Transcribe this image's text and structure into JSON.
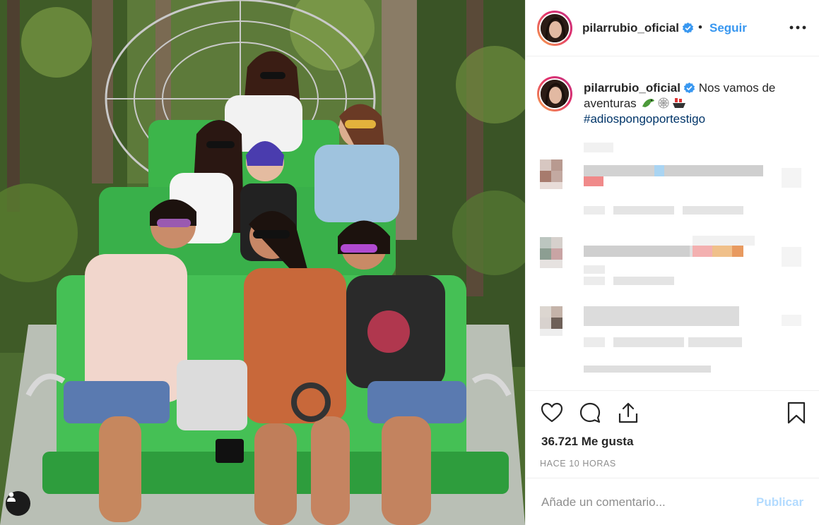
{
  "post": {
    "username": "pilarrubio_oficial",
    "follow_label": "Seguir",
    "separator": "•",
    "caption_text": "Nos vamos de aventuras",
    "hashtag": "#adiospongoportestigo",
    "emoji_icons": [
      "crocodile-icon",
      "spider-web-icon",
      "ship-icon"
    ],
    "likes_text": "36.721 Me gusta",
    "time_text": "HACE 10 HORAS",
    "comment_placeholder": "Añade un comentario...",
    "publish_label": "Publicar"
  },
  "icons": {
    "header": [
      "verified-badge-icon",
      "more-options-icon"
    ],
    "actions": [
      "heart-icon",
      "comment-icon",
      "share-icon",
      "bookmark-icon"
    ],
    "photo": [
      "user-tag-icon"
    ]
  },
  "colors": {
    "link_blue": "#3897f0",
    "hashtag_blue": "#003569",
    "muted_gray": "#8e8e8e",
    "publish_disabled": "#b3dbff",
    "border": "#efefef"
  }
}
